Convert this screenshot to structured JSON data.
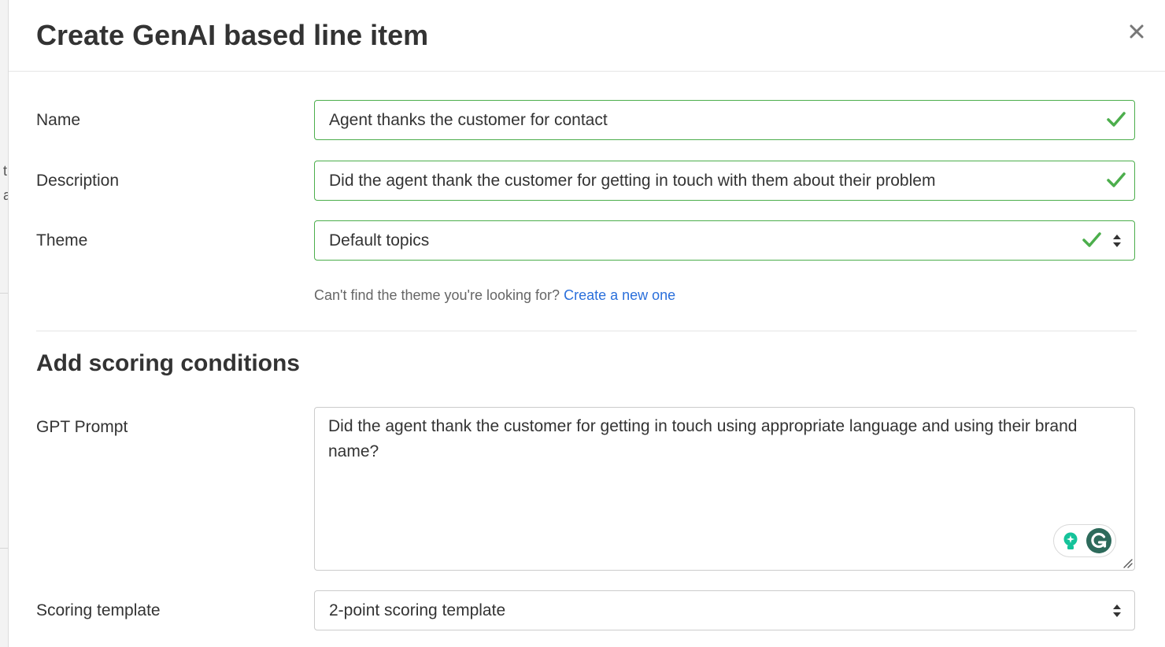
{
  "modal": {
    "title": "Create GenAI based line item",
    "close_icon": "close-icon"
  },
  "form": {
    "name": {
      "label": "Name",
      "value": "Agent thanks the customer for contact",
      "status": "valid"
    },
    "description": {
      "label": "Description",
      "value": "Did the agent thank the customer for getting in touch with them about their problem",
      "status": "valid"
    },
    "theme": {
      "label": "Theme",
      "value": "Default topics",
      "status": "valid",
      "helper_text": "Can't find the theme you're looking for?",
      "helper_link": "Create a new one"
    }
  },
  "scoring": {
    "title": "Add scoring conditions",
    "gpt_prompt": {
      "label": "GPT Prompt",
      "value": "Did the agent thank the customer for getting in touch using appropriate language and using their brand name?"
    },
    "template": {
      "label": "Scoring template",
      "value": "2-point scoring template"
    }
  },
  "colors": {
    "valid_border": "#4cae4c",
    "valid_check": "#4cae4c",
    "link": "#2a6fdb",
    "grammarly": "#15c39a"
  },
  "icons": {
    "valid": "checkmark-icon",
    "select": "sort-caret-icon",
    "grammarly_bulb": "lightbulb-icon",
    "grammarly_logo": "grammarly-icon",
    "resize": "resize-handle-icon"
  }
}
